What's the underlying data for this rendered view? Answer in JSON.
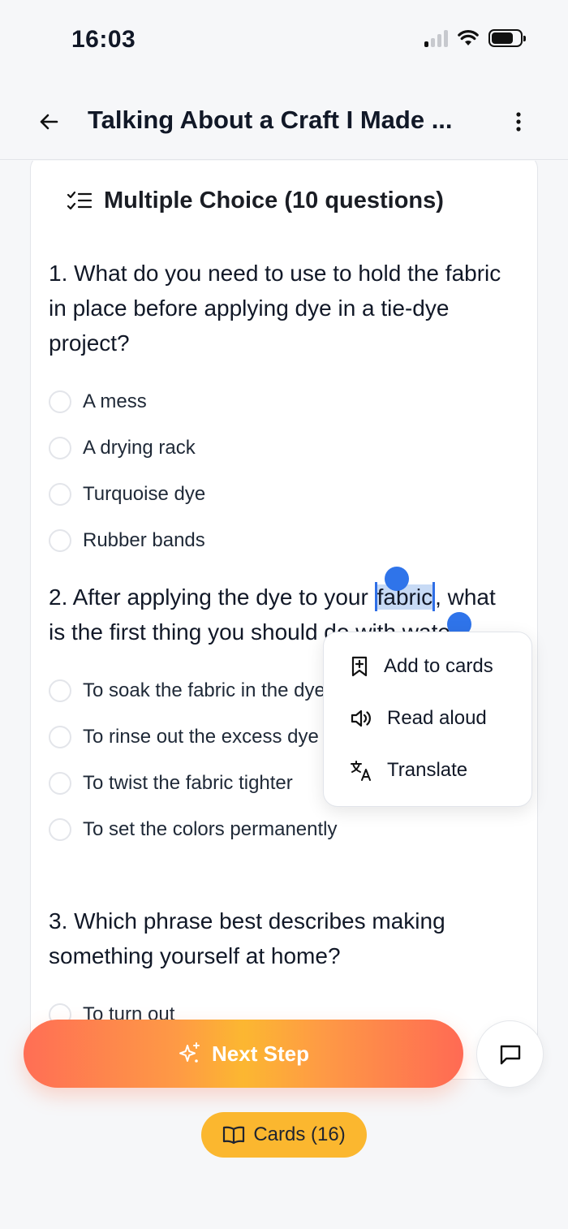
{
  "status_bar": {
    "time": "16:03"
  },
  "header": {
    "title": "Talking About a Craft I Made ..."
  },
  "section": {
    "title": "Multiple Choice (10 questions)"
  },
  "questions": [
    {
      "text": "1. What do you need to use to hold the fabric in place before applying dye in a tie-dye project?",
      "options": [
        "A mess",
        "A drying rack",
        "Turquoise dye",
        "Rubber bands"
      ]
    },
    {
      "text_before": "2. After applying the dye to your ",
      "selected_word": "fabric",
      "text_after": ", what is the first thing you should do with water?",
      "options": [
        "To soak the fabric in the dye",
        "To rinse out the excess dye",
        "To twist the fabric tighter",
        "To set the colors permanently"
      ]
    },
    {
      "text": "3. Which phrase best describes making something yourself at home?",
      "options": [
        "To turn out"
      ]
    }
  ],
  "context_menu": {
    "add_to_cards": "Add to cards",
    "read_aloud": "Read aloud",
    "translate": "Translate"
  },
  "actions": {
    "next_step": "Next Step",
    "cards": "Cards (16)"
  },
  "colors": {
    "selection": "#c7daf5",
    "handle": "#2f74ea",
    "accent_orange": "#ff6e55",
    "accent_yellow": "#fbb72f"
  }
}
